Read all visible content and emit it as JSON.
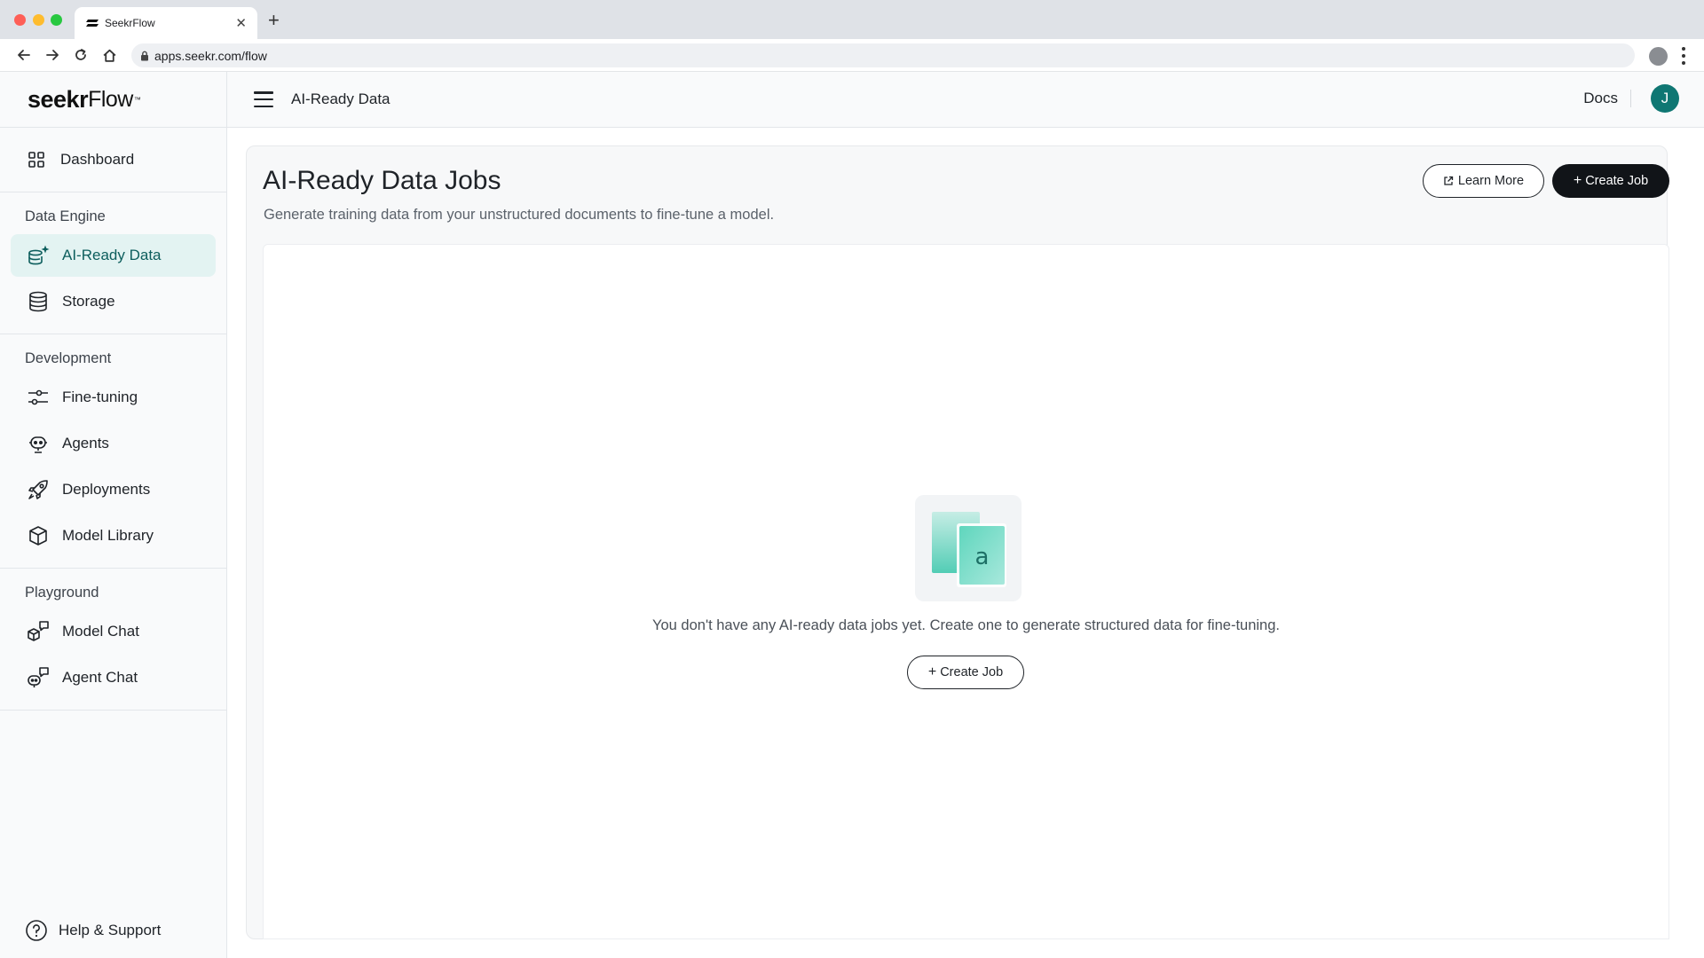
{
  "browser": {
    "tab_title": "SeekrFlow",
    "url": "apps.seekr.com/flow"
  },
  "logo": {
    "brand_bold": "seekr",
    "brand_light": "Flow",
    "tm": "™"
  },
  "sidebar": {
    "dashboard": "Dashboard",
    "sections": [
      {
        "title": "Data Engine",
        "items": [
          "AI-Ready Data",
          "Storage"
        ]
      },
      {
        "title": "Development",
        "items": [
          "Fine-tuning",
          "Agents",
          "Deployments",
          "Model Library"
        ]
      },
      {
        "title": "Playground",
        "items": [
          "Model Chat",
          "Agent Chat"
        ]
      }
    ],
    "active_item": "AI-Ready Data",
    "help": "Help & Support"
  },
  "header": {
    "title": "AI-Ready Data",
    "docs": "Docs",
    "avatar_initial": "J"
  },
  "main": {
    "title": "AI-Ready Data Jobs",
    "subtitle": "Generate training data from your unstructured documents to fine-tune a model.",
    "learn_more": "Learn More",
    "create_job": "Create Job",
    "empty_message": "You don't have any AI-ready data jobs yet. Create one to generate structured data for fine-tuning.",
    "empty_create_job": "Create Job",
    "illustration_letter": "a"
  },
  "colors": {
    "accent": "#0f7773",
    "active_bg": "#e3f3f2",
    "primary_button": "#111418"
  }
}
